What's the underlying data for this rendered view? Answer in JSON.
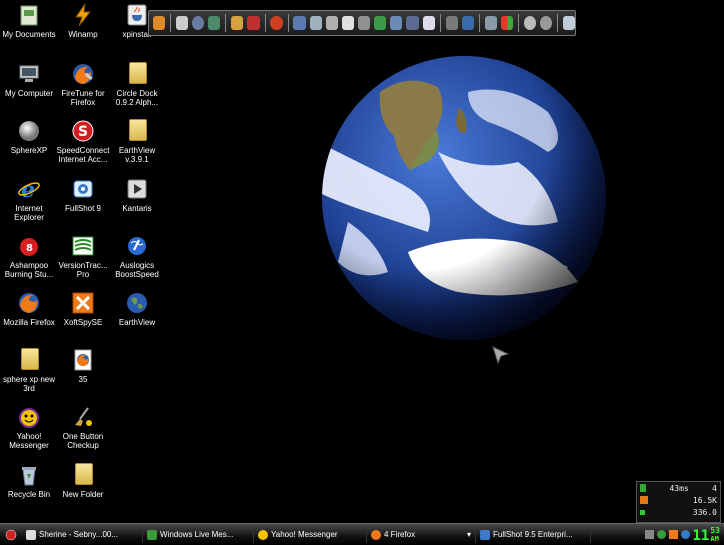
{
  "desktop_icons": [
    {
      "label": "My Documents",
      "icon": "my-documents-icon"
    },
    {
      "label": "Winamp",
      "icon": "winamp-icon"
    },
    {
      "label": "xpinstall",
      "icon": "java-installer-icon"
    },
    {
      "label": "My Computer",
      "icon": "computer-icon"
    },
    {
      "label": "FireTune for Firefox",
      "icon": "firetune-icon"
    },
    {
      "label": "Circle Dock 0.9.2 Alph...",
      "icon": "folder-icon"
    },
    {
      "label": "SphereXP",
      "icon": "sphere-icon"
    },
    {
      "label": "SpeedConnect Internet Acc...",
      "icon": "speedconnect-icon"
    },
    {
      "label": "EarthView v.3.9.1",
      "icon": "folder-icon"
    },
    {
      "label": "Internet Explorer",
      "icon": "internet-explorer-icon"
    },
    {
      "label": "FullShot 9",
      "icon": "fullshot-icon"
    },
    {
      "label": "Kantaris",
      "icon": "play-icon"
    },
    {
      "label": "Ashampoo Burning Stu...",
      "icon": "ashampoo-icon"
    },
    {
      "label": "VersionTrac... Pro",
      "icon": "versiontracker-icon"
    },
    {
      "label": "Auslogics BoostSpeed",
      "icon": "globe-icon"
    },
    {
      "label": "Mozilla Firefox",
      "icon": "firefox-icon"
    },
    {
      "label": "XoftSpySE",
      "icon": "xoftspy-icon"
    },
    {
      "label": "EarthView",
      "icon": "earth-icon"
    },
    {
      "label": "sphere xp new 3rd",
      "icon": "folder-icon"
    },
    {
      "label": "35",
      "icon": "firefox-document-icon"
    },
    {
      "label": "Yahoo! Messenger",
      "icon": "yahoo-messenger-icon"
    },
    {
      "label": "One Button Checkup",
      "icon": "broom-icon"
    },
    {
      "label": "Recycle Bin",
      "icon": "recycle-bin-icon"
    },
    {
      "label": "New Folder",
      "icon": "folder-icon"
    }
  ],
  "monitor": {
    "ping": "43ms",
    "count": "4",
    "speed": "16.5K",
    "total": "336.0"
  },
  "taskbar": {
    "tasks": [
      {
        "label": "Sherine - Sebny...00...",
        "icon": "window-icon"
      },
      {
        "label": "Windows Live Mes...",
        "icon": "windows-live-messenger-icon"
      },
      {
        "label": "Yahoo! Messenger",
        "icon": "yahoo-messenger-icon"
      },
      {
        "label": "4 Firefox",
        "icon": "firefox-icon"
      },
      {
        "label": "FullShot 9.5 Enterpri...",
        "icon": "fullshot-icon"
      }
    ],
    "clock_hour": "11",
    "clock_minute": "53",
    "clock_ampm": "AM"
  },
  "colors": {
    "desktop_bg": "#000000",
    "clock": "#33ff33"
  }
}
